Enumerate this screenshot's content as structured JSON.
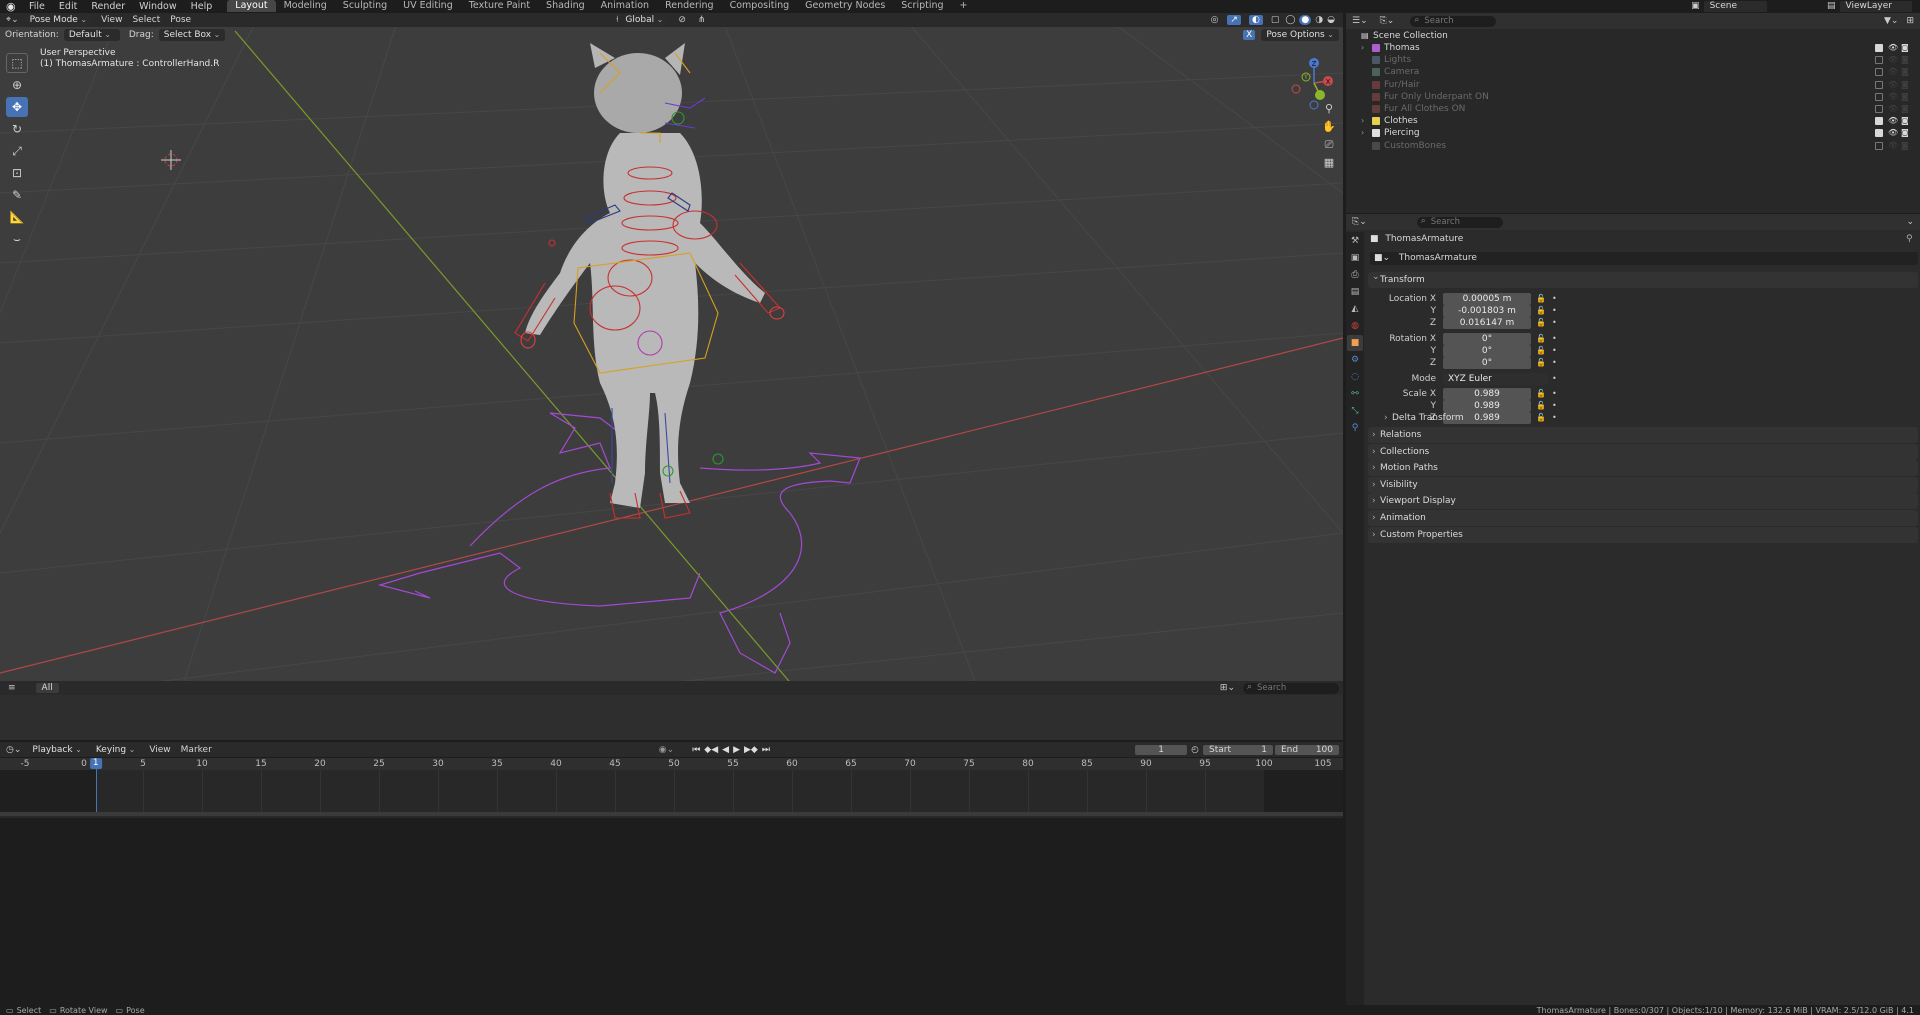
{
  "menu": {
    "items": [
      "File",
      "Edit",
      "Render",
      "Window",
      "Help"
    ],
    "workspaces": [
      "Layout",
      "Modeling",
      "Sculpting",
      "UV Editing",
      "Texture Paint",
      "Shading",
      "Animation",
      "Rendering",
      "Compositing",
      "Geometry Nodes",
      "Scripting",
      "+"
    ],
    "active_workspace": "Layout",
    "scene": "Scene",
    "view_layer": "ViewLayer"
  },
  "viewport": {
    "mode": "Pose Mode",
    "menus": [
      "View",
      "Select",
      "Pose"
    ],
    "transform_orientation": "Global",
    "orientation_label": "Orientation:",
    "orientation_value": "Default",
    "drag_label": "Drag:",
    "drag_value": "Select Box",
    "pose_options": "Pose Options",
    "view_name": "User Perspective",
    "active_bone": "(1) ThomasArmature : ControllerHand.R",
    "gizmo": {
      "x": "X",
      "y": "Y",
      "z": "Z"
    }
  },
  "lower_editor": {
    "filter": "All",
    "search_placeholder": "Search"
  },
  "timeline": {
    "menus": [
      "Playback",
      "Keying",
      "View",
      "Marker"
    ],
    "current_frame": "1",
    "start_label": "Start",
    "start": "1",
    "end_label": "End",
    "end": "100",
    "ticks": [
      "-5",
      "0",
      "5",
      "10",
      "15",
      "20",
      "25",
      "30",
      "35",
      "40",
      "45",
      "50",
      "55",
      "60",
      "65",
      "70",
      "75",
      "80",
      "85",
      "90",
      "95",
      "100",
      "105"
    ],
    "playhead_label": "1"
  },
  "outliner": {
    "search_placeholder": "Search",
    "root": "Scene Collection",
    "rows": [
      {
        "name": "Thomas",
        "color": "#b05fd0",
        "checked": true,
        "expandable": true,
        "dim": false
      },
      {
        "name": "Lights",
        "color": "#8ab4d8",
        "checked": false,
        "expandable": false,
        "dim": true
      },
      {
        "name": "Camera",
        "color": "#8ad8a8",
        "checked": false,
        "expandable": false,
        "dim": true
      },
      {
        "name": "Fur/Hair",
        "color": "#d86060",
        "checked": false,
        "expandable": false,
        "dim": true
      },
      {
        "name": "Fur Only Underpant ON",
        "color": "#d86060",
        "checked": false,
        "expandable": false,
        "dim": true
      },
      {
        "name": "Fur All Clothes ON",
        "color": "#d86060",
        "checked": false,
        "expandable": false,
        "dim": true
      },
      {
        "name": "Clothes",
        "color": "#e8d050",
        "checked": true,
        "expandable": true,
        "dim": false
      },
      {
        "name": "Piercing",
        "color": "#e0e0e0",
        "checked": true,
        "expandable": true,
        "dim": false
      },
      {
        "name": "CustomBones",
        "color": "#888888",
        "checked": false,
        "expandable": false,
        "dim": true
      }
    ]
  },
  "properties": {
    "search_placeholder": "Search",
    "object_name": "ThomasArmature",
    "datablock_name": "ThomasArmature",
    "transform": {
      "title": "Transform",
      "location_label": "Location X",
      "location": [
        "0.00005 m",
        "-0.001803 m",
        "0.016147 m"
      ],
      "rotation_label": "Rotation X",
      "rotation": [
        "0°",
        "0°",
        "0°"
      ],
      "mode_label": "Mode",
      "mode": "XYZ Euler",
      "scale_label": "Scale X",
      "scale": [
        "0.989",
        "0.989",
        "0.989"
      ],
      "y_label": "Y",
      "z_label": "Z",
      "delta": "Delta Transform"
    },
    "panels": [
      "Relations",
      "Collections",
      "Motion Paths",
      "Visibility",
      "Viewport Display",
      "Animation",
      "Custom Properties"
    ]
  },
  "statusbar": {
    "left": [
      "Select",
      "Rotate View",
      "Pose"
    ],
    "right": "ThomasArmature | Bones:0/307 | Objects:1/10 | Memory: 132.6 MiB | VRAM: 2.5/12.0 GiB | 4.1"
  },
  "colors": {
    "accent": "#4772b3",
    "x_axis": "#c84a4a",
    "y_axis": "#8ab82a",
    "z_axis": "#4a7ad0",
    "rig": "#b04ad0"
  }
}
